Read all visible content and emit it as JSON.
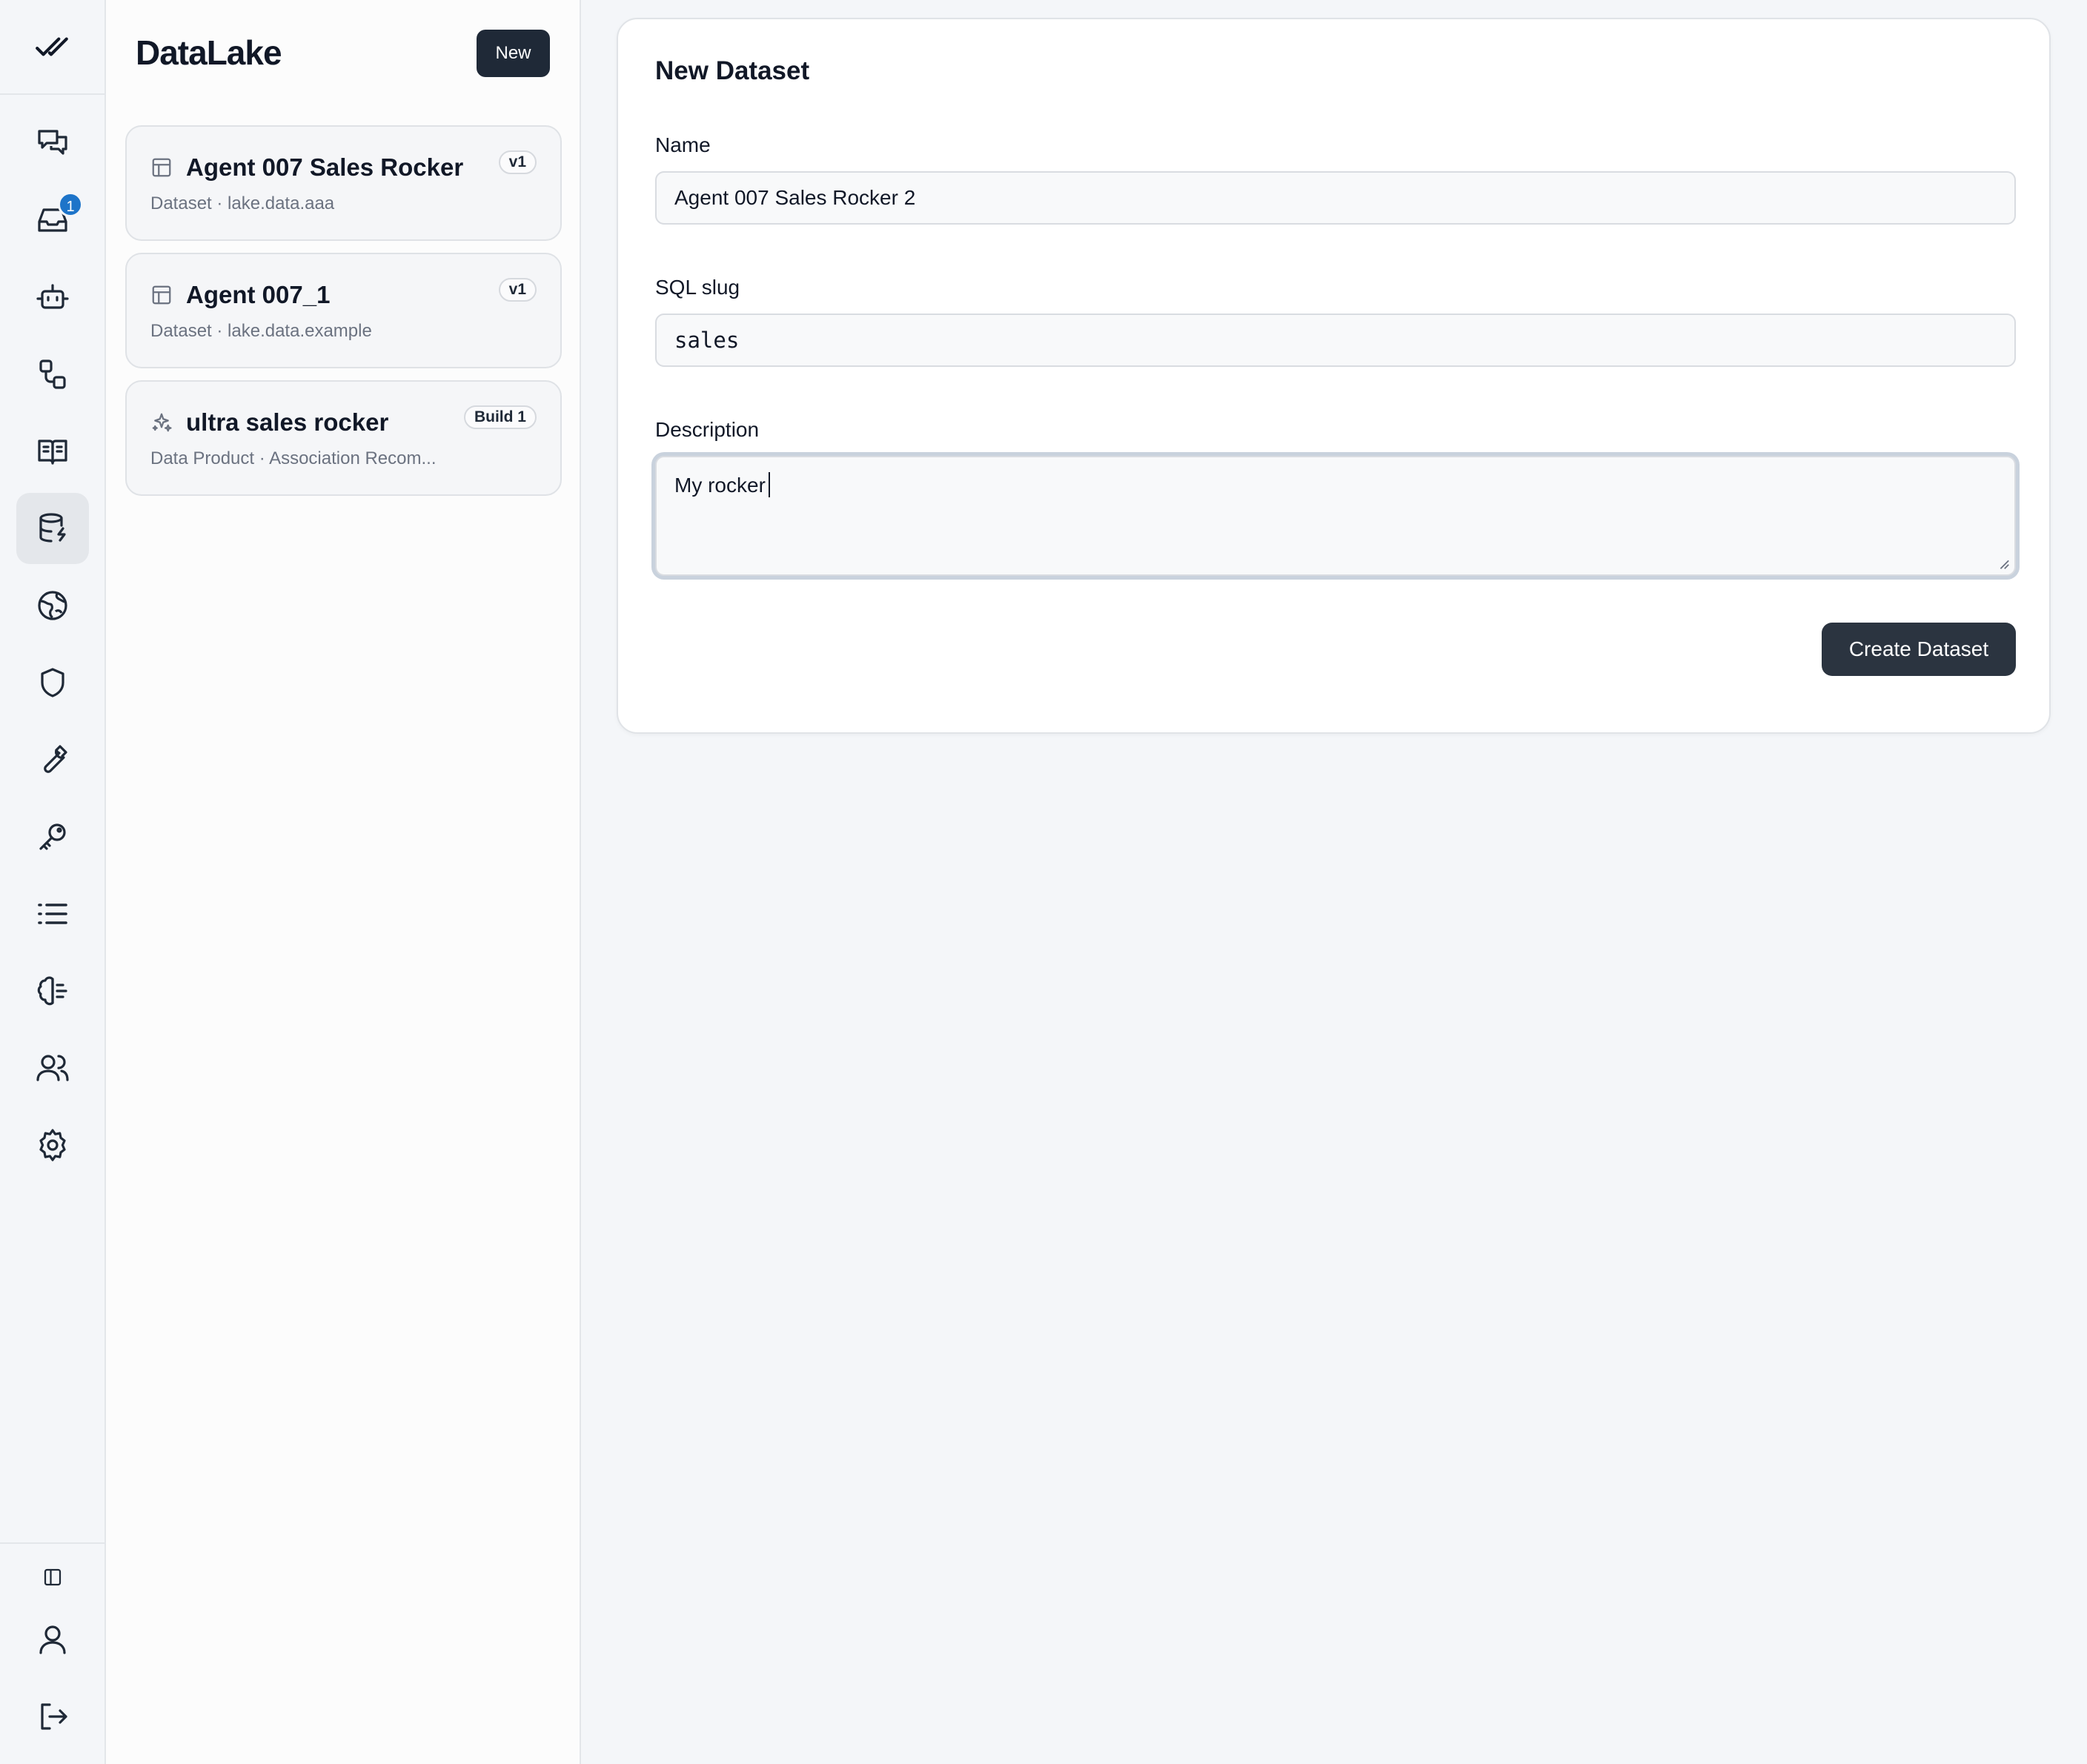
{
  "rail": {
    "items": [
      {
        "icon": "chat-icon"
      },
      {
        "icon": "inbox-icon",
        "badge": "1"
      },
      {
        "icon": "bot-icon"
      },
      {
        "icon": "workflow-icon"
      },
      {
        "icon": "book-icon"
      },
      {
        "icon": "database-icon",
        "active": true
      },
      {
        "icon": "globe-icon"
      },
      {
        "icon": "shield-icon"
      },
      {
        "icon": "wrench-icon"
      },
      {
        "icon": "key-icon"
      },
      {
        "icon": "list-icon"
      },
      {
        "icon": "brain-icon"
      },
      {
        "icon": "users-icon"
      },
      {
        "icon": "gear-icon"
      }
    ],
    "bottom": [
      {
        "icon": "sidebar-toggle-icon"
      },
      {
        "icon": "user-icon"
      },
      {
        "icon": "logout-icon"
      }
    ]
  },
  "sidebar": {
    "title": "DataLake",
    "new_label": "New",
    "items": [
      {
        "title": "Agent 007 Sales Rocker",
        "subtitle": "Dataset · lake.data.aaa",
        "badge": "v1",
        "icon": "table-icon"
      },
      {
        "title": "Agent 007_1",
        "subtitle": "Dataset · lake.data.example",
        "badge": "v1",
        "icon": "table-icon"
      },
      {
        "title": "ultra sales rocker",
        "subtitle": "Data Product · Association Recom...",
        "badge": "Build 1",
        "icon": "sparkles-icon"
      }
    ]
  },
  "form": {
    "title": "New Dataset",
    "name_label": "Name",
    "name_value": "Agent 007 Sales Rocker 2",
    "slug_label": "SQL slug",
    "slug_value": "sales",
    "description_label": "Description",
    "description_value": "My rocker",
    "submit_label": "Create Dataset"
  },
  "colors": {
    "accent_dark": "#1f2937",
    "badge_blue": "#1d74c9",
    "background": "#f4f6f9"
  }
}
